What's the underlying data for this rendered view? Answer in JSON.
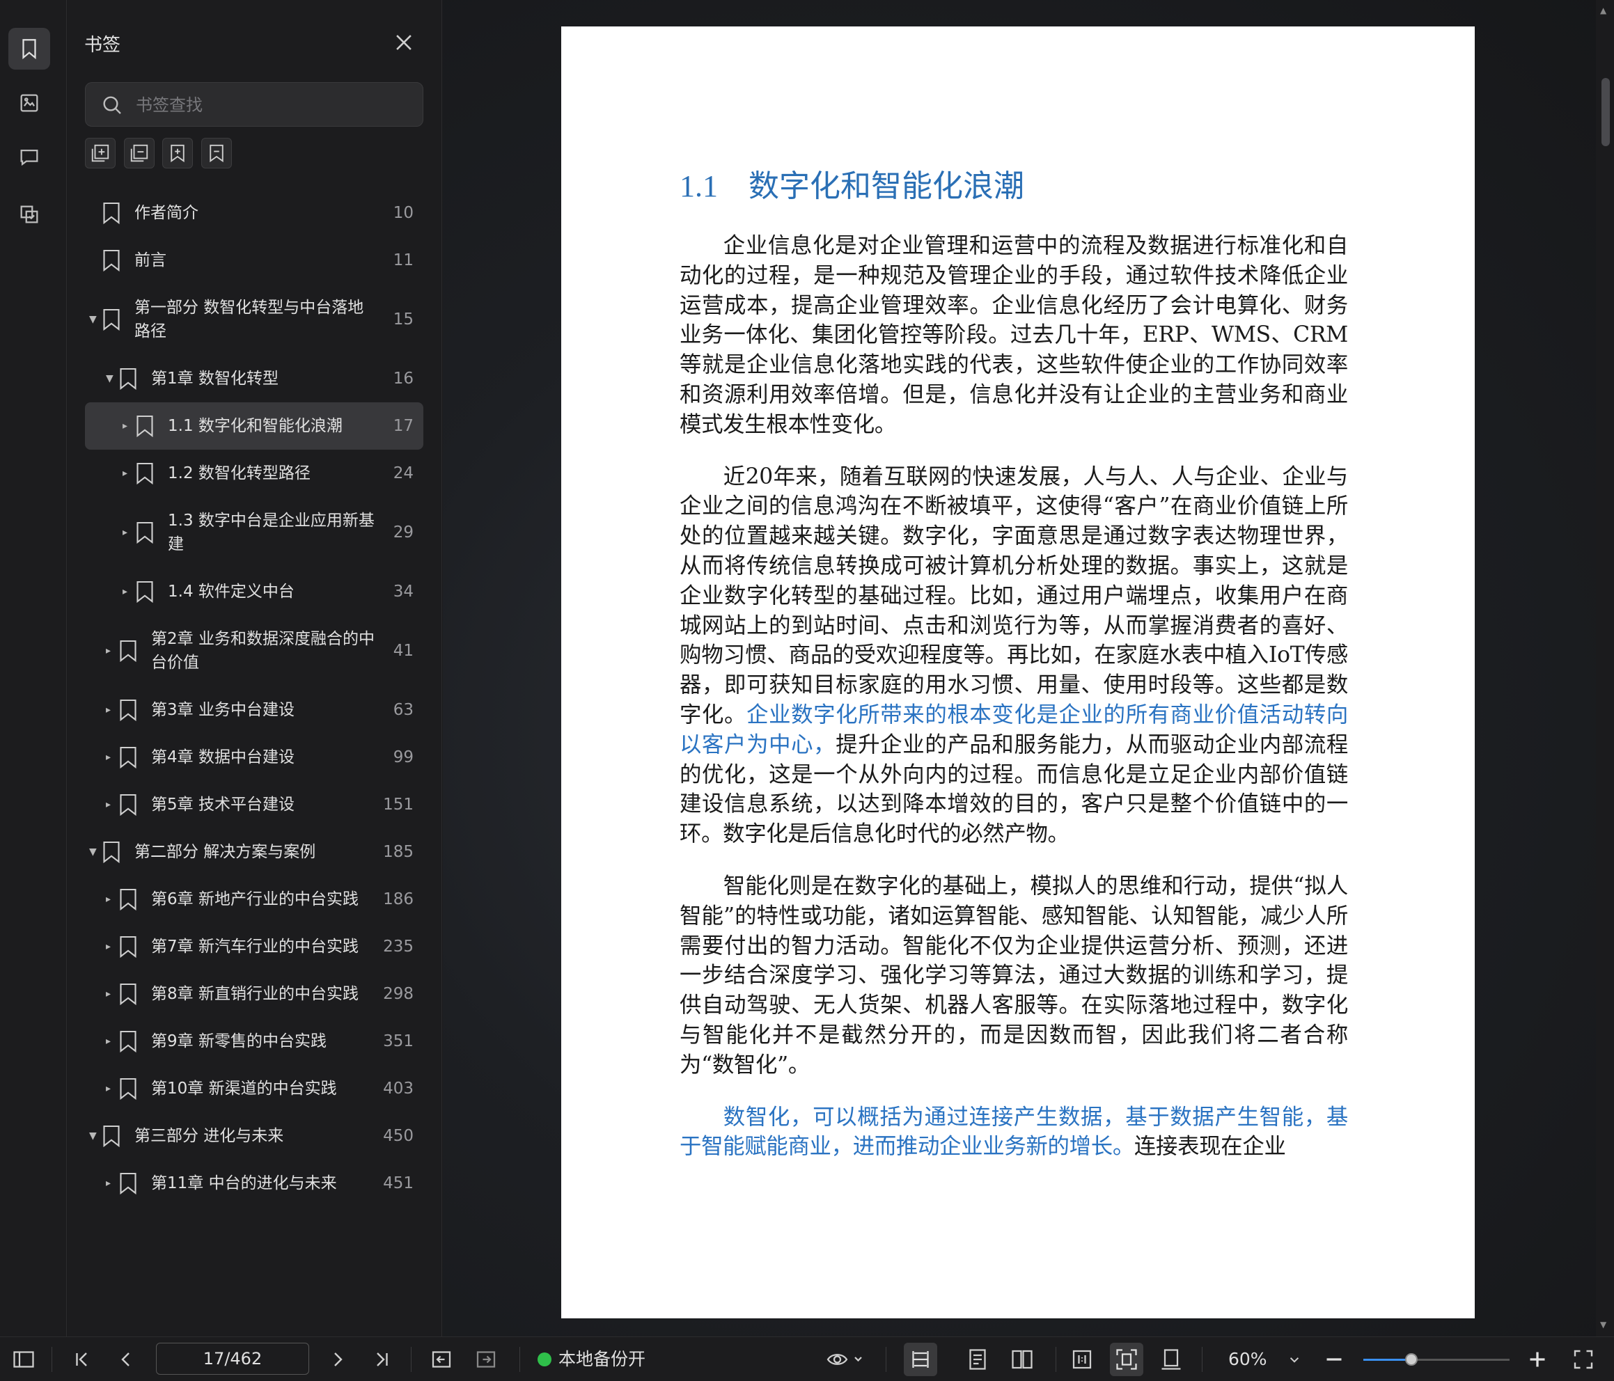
{
  "sidebar_panel": {
    "title": "书签",
    "search_placeholder": "书签查找"
  },
  "bookmarks": [
    {
      "label": "作者简介",
      "page": "10",
      "level": 0,
      "caret": "",
      "selected": false
    },
    {
      "label": "前言",
      "page": "11",
      "level": 0,
      "caret": "",
      "selected": false
    },
    {
      "label": "第一部分 数智化转型与中台落地路径",
      "page": "15",
      "level": 0,
      "caret": "down",
      "selected": false
    },
    {
      "label": "第1章 数智化转型",
      "page": "16",
      "level": 1,
      "caret": "down",
      "selected": false
    },
    {
      "label": "1.1 数字化和智能化浪潮",
      "page": "17",
      "level": 2,
      "caret": "right",
      "selected": true
    },
    {
      "label": "1.2 数智化转型路径",
      "page": "24",
      "level": 2,
      "caret": "right",
      "selected": false
    },
    {
      "label": "1.3 数字中台是企业应用新基建",
      "page": "29",
      "level": 2,
      "caret": "right",
      "selected": false
    },
    {
      "label": "1.4 软件定义中台",
      "page": "34",
      "level": 2,
      "caret": "right",
      "selected": false
    },
    {
      "label": "第2章 业务和数据深度融合的中台价值",
      "page": "41",
      "level": 1,
      "caret": "right",
      "selected": false
    },
    {
      "label": "第3章 业务中台建设",
      "page": "63",
      "level": 1,
      "caret": "right",
      "selected": false
    },
    {
      "label": "第4章 数据中台建设",
      "page": "99",
      "level": 1,
      "caret": "right",
      "selected": false
    },
    {
      "label": "第5章 技术平台建设",
      "page": "151",
      "level": 1,
      "caret": "right",
      "selected": false
    },
    {
      "label": "第二部分 解决方案与案例",
      "page": "185",
      "level": 0,
      "caret": "down",
      "selected": false
    },
    {
      "label": "第6章 新地产行业的中台实践",
      "page": "186",
      "level": 1,
      "caret": "right",
      "selected": false
    },
    {
      "label": "第7章 新汽车行业的中台实践",
      "page": "235",
      "level": 1,
      "caret": "right",
      "selected": false
    },
    {
      "label": "第8章 新直销行业的中台实践",
      "page": "298",
      "level": 1,
      "caret": "right",
      "selected": false
    },
    {
      "label": "第9章 新零售的中台实践",
      "page": "351",
      "level": 1,
      "caret": "right",
      "selected": false
    },
    {
      "label": "第10章 新渠道的中台实践",
      "page": "403",
      "level": 1,
      "caret": "right",
      "selected": false
    },
    {
      "label": "第三部分 进化与未来",
      "page": "450",
      "level": 0,
      "caret": "down",
      "selected": false
    },
    {
      "label": "第11章 中台的进化与未来",
      "page": "451",
      "level": 1,
      "caret": "right",
      "selected": false
    }
  ],
  "document": {
    "section_number": "1.1",
    "section_title": "数字化和智能化浪潮",
    "paragraphs": [
      {
        "parts": [
          {
            "text": "企业信息化是对企业管理和运营中的流程及数据进行标准化和自动化的过程，是一种规范及管理企业的手段，通过软件技术降低企业运营成本，提高企业管理效率。企业信息化经历了会计电算化、财务业务一体化、集团化管控等阶段。过去几十年，ERP、WMS、CRM等就是企业信息化落地实践的代表，这些软件使企业的工作协同效率和资源利用效率倍增。但是，信息化并没有让企业的主营业务和商业模式发生根本性变化。",
            "highlight": false
          }
        ]
      },
      {
        "parts": [
          {
            "text": "近20年来，随着互联网的快速发展，人与人、人与企业、企业与企业之间的信息鸿沟在不断被填平，这使得“客户”在商业价值链上所处的位置越来越关键。数字化，字面意思是通过数字表达物理世界，从而将传统信息转换成可被计算机分析处理的数据。事实上，这就是企业数字化转型的基础过程。比如，通过用户端埋点，收集用户在商城网站上的到站时间、点击和浏览行为等，从而掌握消费者的喜好、购物习惯、商品的受欢迎程度等。再比如，在家庭水表中植入IoT传感器，即可获知目标家庭的用水习惯、用量、使用时段等。这些都是数字化。",
            "highlight": false
          },
          {
            "text": "企业数字化所带来的根本变化是企业的所有商业价值活动转向以客户为中心，",
            "highlight": true
          },
          {
            "text": "提升企业的产品和服务能力，从而驱动企业内部流程的优化，这是一个从外向内的过程。而信息化是立足企业内部价值链建设信息系统，以达到降本增效的目的，客户只是整个价值链中的一环。数字化是后信息化时代的必然产物。",
            "highlight": false
          }
        ]
      },
      {
        "parts": [
          {
            "text": "智能化则是在数字化的基础上，模拟人的思维和行动，提供“拟人智能”的特性或功能，诸如运算智能、感知智能、认知智能，减少人所需要付出的智力活动。智能化不仅为企业提供运营分析、预测，还进一步结合深度学习、强化学习等算法，通过大数据的训练和学习，提供自动驾驶、无人货架、机器人客服等。在实际落地过程中，数字化与智能化并不是截然分开的，而是因数而智，因此我们将二者合称为“数智化”。",
            "highlight": false
          }
        ]
      },
      {
        "parts": [
          {
            "text": "数智化，可以概括为通过连接产生数据，基于数据产生智能，基于智能赋能商业，进而推动企业业务新的增长。",
            "highlight": true
          },
          {
            "text": "连接表现在企业",
            "highlight": false
          }
        ]
      }
    ]
  },
  "statusbar": {
    "page_indicator": "17/462",
    "backup_label": "本地备份开",
    "zoom_level": "60%",
    "zoom_fraction": 0.33
  },
  "colors": {
    "accent": "#2a73c2",
    "backup_dot": "#2fbf4a"
  },
  "icons": {
    "rail": [
      "bookmark-icon",
      "thumbnail-icon",
      "comment-icon",
      "attachment-icon"
    ],
    "bookmark_tools": [
      "expand-all-icon",
      "collapse-all-icon",
      "add-bookmark-icon",
      "remove-bookmark-icon"
    ]
  }
}
